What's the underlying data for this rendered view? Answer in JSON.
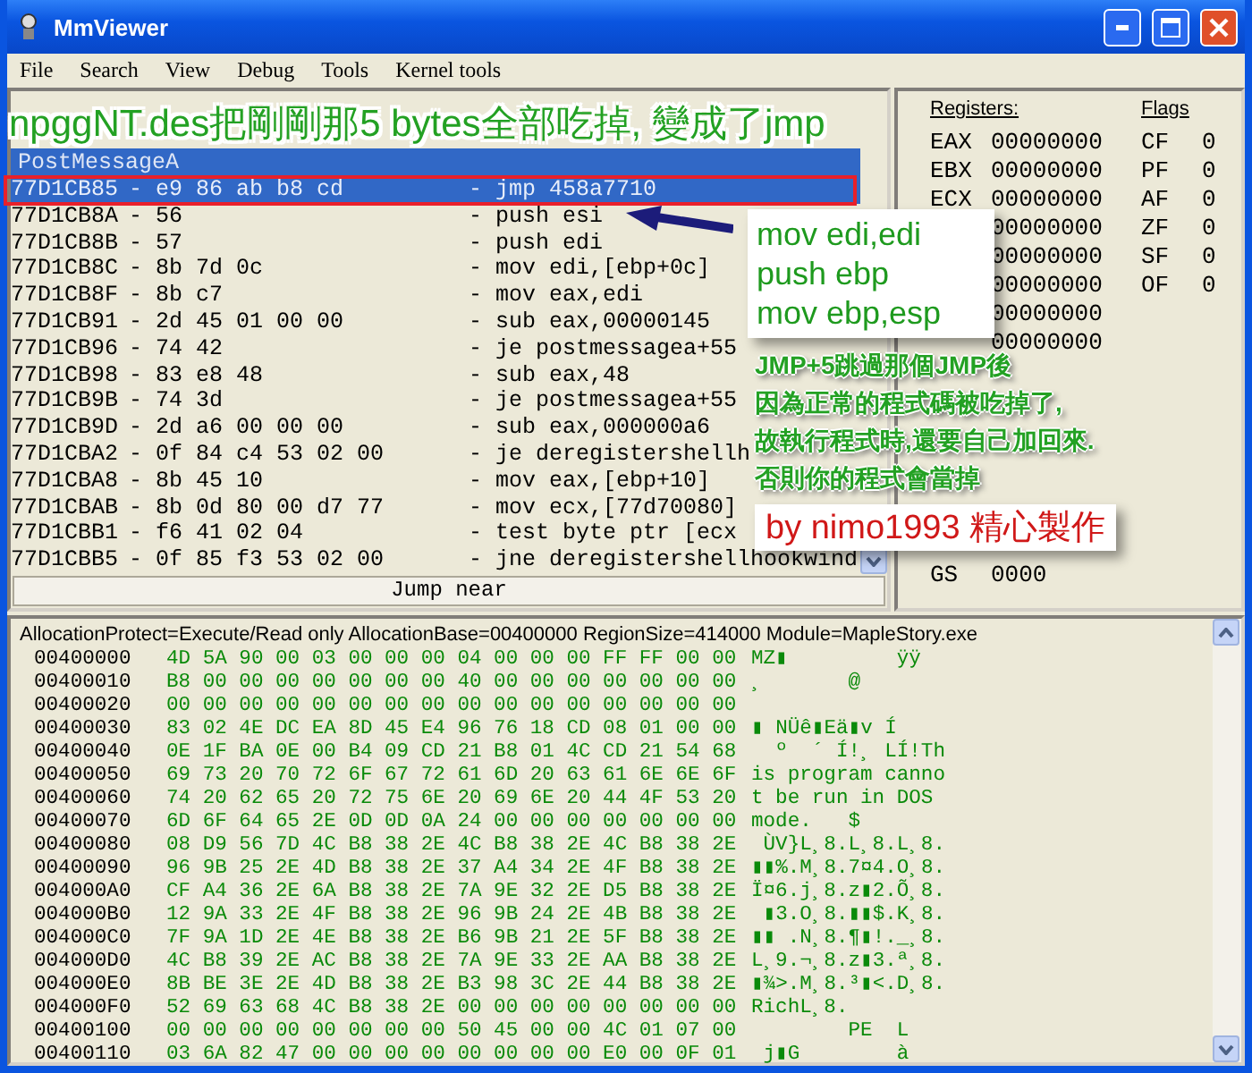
{
  "window": {
    "title": "MmViewer"
  },
  "menu": [
    "File",
    "Search",
    "View",
    "Debug",
    "Tools",
    "Kernel tools"
  ],
  "disassembler": {
    "symbol": "PostMessageA",
    "rows": [
      {
        "address": "77D1CB85",
        "bytes": "- e9 86 ab b8 cd",
        "instruction": "- jmp 458a7710",
        "selected": true
      },
      {
        "address": "77D1CB8A",
        "bytes": "- 56",
        "instruction": "- push esi",
        "selected": false
      },
      {
        "address": "77D1CB8B",
        "bytes": "- 57",
        "instruction": "- push edi",
        "selected": false
      },
      {
        "address": "77D1CB8C",
        "bytes": "- 8b 7d 0c",
        "instruction": "- mov edi,[ebp+0c]",
        "selected": false
      },
      {
        "address": "77D1CB8F",
        "bytes": "- 8b c7",
        "instruction": "- mov eax,edi",
        "selected": false
      },
      {
        "address": "77D1CB91",
        "bytes": "- 2d 45 01 00 00",
        "instruction": "- sub eax,00000145",
        "selected": false
      },
      {
        "address": "77D1CB96",
        "bytes": "- 74 42",
        "instruction": "- je postmessagea+55",
        "selected": false
      },
      {
        "address": "77D1CB98",
        "bytes": "- 83 e8 48",
        "instruction": "- sub eax,48",
        "selected": false
      },
      {
        "address": "77D1CB9B",
        "bytes": "- 74 3d",
        "instruction": "- je postmessagea+55",
        "selected": false
      },
      {
        "address": "77D1CB9D",
        "bytes": "- 2d a6 00 00 00",
        "instruction": "- sub eax,000000a6",
        "selected": false
      },
      {
        "address": "77D1CBA2",
        "bytes": "- 0f 84 c4 53 02 00",
        "instruction": "- je deregistershellh",
        "selected": false
      },
      {
        "address": "77D1CBA8",
        "bytes": "- 8b 45 10",
        "instruction": "- mov eax,[ebp+10]",
        "selected": false
      },
      {
        "address": "77D1CBAB",
        "bytes": "- 8b 0d 80 00 d7 77",
        "instruction": "- mov ecx,[77d70080]",
        "selected": false
      },
      {
        "address": "77D1CBB1",
        "bytes": "- f6 41 02 04",
        "instruction": "- test byte ptr [ecx",
        "selected": false
      },
      {
        "address": "77D1CBB5",
        "bytes": "- 0f 85 f3 53 02 00",
        "instruction": "- jne deregistershellhookwind",
        "selected": false
      }
    ],
    "status": "Jump near"
  },
  "registers": {
    "heading": "Registers:",
    "items": [
      {
        "name": "EAX",
        "value": "00000000"
      },
      {
        "name": "EBX",
        "value": "00000000"
      },
      {
        "name": "ECX",
        "value": "00000000"
      },
      {
        "value": "00000000"
      },
      {
        "value": "00000000"
      },
      {
        "value": "00000000"
      },
      {
        "value": "00000000"
      },
      {
        "value": "00000000"
      }
    ],
    "segments": [
      {
        "name": "GS",
        "value": "0000"
      }
    ]
  },
  "flags": {
    "heading": "Flags",
    "items": [
      {
        "name": "CF",
        "value": "0"
      },
      {
        "name": "PF",
        "value": "0"
      },
      {
        "name": "AF",
        "value": "0"
      },
      {
        "name": "ZF",
        "value": "0"
      },
      {
        "name": "SF",
        "value": "0"
      },
      {
        "name": "OF",
        "value": "0"
      }
    ]
  },
  "memory": {
    "info": "AllocationProtect=Execute/Read only  AllocationBase=00400000 RegionSize=414000 Module=MapleStory.exe",
    "rows": [
      {
        "address": "00400000",
        "bytes": "4D 5A 90 00 03 00 00 00 04 00 00 00 FF FF 00 00",
        "ascii": "MZ▮         ÿÿ"
      },
      {
        "address": "00400010",
        "bytes": "B8 00 00 00 00 00 00 00 40 00 00 00 00 00 00 00",
        "ascii": "¸       @"
      },
      {
        "address": "00400020",
        "bytes": "00 00 00 00 00 00 00 00 00 00 00 00 00 00 00 00"
      },
      {
        "address": "00400030",
        "bytes": "83 02 4E DC EA 8D 45 E4 96 76 18 CD 08 01 00 00",
        "ascii": "▮ NÜê▮Eä▮v Í"
      },
      {
        "address": "00400040",
        "bytes": "0E 1F BA 0E 00 B4 09 CD 21 B8 01 4C CD 21 54 68",
        "ascii": "  º  ´ Í!¸ LÍ!Th"
      },
      {
        "address": "00400050",
        "bytes": "69 73 20 70 72 6F 67 72 61 6D 20 63 61 6E 6E 6F",
        "ascii": "is program canno"
      },
      {
        "address": "00400060",
        "bytes": "74 20 62 65 20 72 75 6E 20 69 6E 20 44 4F 53 20",
        "ascii": "t be run in DOS"
      },
      {
        "address": "00400070",
        "bytes": "6D 6F 64 65 2E 0D 0D 0A 24 00 00 00 00 00 00 00",
        "ascii": "mode.   $"
      },
      {
        "address": "00400080",
        "bytes": "08 D9 56 7D 4C B8 38 2E 4C B8 38 2E 4C B8 38 2E",
        "ascii": " ÙV}L¸8.L¸8.L¸8."
      },
      {
        "address": "00400090",
        "bytes": "96 9B 25 2E 4D B8 38 2E 37 A4 34 2E 4F B8 38 2E",
        "ascii": "▮▮%.M¸8.7¤4.O¸8."
      },
      {
        "address": "004000A0",
        "bytes": "CF A4 36 2E 6A B8 38 2E 7A 9E 32 2E D5 B8 38 2E",
        "ascii": "Ï¤6.j¸8.z▮2.Õ¸8."
      },
      {
        "address": "004000B0",
        "bytes": "12 9A 33 2E 4F B8 38 2E 96 9B 24 2E 4B B8 38 2E",
        "ascii": " ▮3.O¸8.▮▮$.K¸8."
      },
      {
        "address": "004000C0",
        "bytes": "7F 9A 1D 2E 4E B8 38 2E B6 9B 21 2E 5F B8 38 2E",
        "ascii": "▮▮ .N¸8.¶▮!._¸8."
      },
      {
        "address": "004000D0",
        "bytes": "4C B8 39 2E AC B8 38 2E 7A 9E 33 2E AA B8 38 2E",
        "ascii": "L¸9.¬¸8.z▮3.ª¸8."
      },
      {
        "address": "004000E0",
        "bytes": "8B BE 3E 2E 4D B8 38 2E B3 98 3C 2E 44 B8 38 2E",
        "ascii": "▮¾>.M¸8.³▮<.D¸8."
      },
      {
        "address": "004000F0",
        "bytes": "52 69 63 68 4C B8 38 2E 00 00 00 00 00 00 00 00",
        "ascii": "RichL¸8."
      },
      {
        "address": "00400100",
        "bytes": "00 00 00 00 00 00 00 00 50 45 00 00 4C 01 07 00",
        "ascii": "        PE  L"
      },
      {
        "address": "00400110",
        "bytes": "03 6A 82 47 00 00 00 00 00 00 00 00 E0 00 0F 01",
        "ascii": " j▮G        à"
      }
    ]
  },
  "annotations": [
    {
      "kind": "banner",
      "text": "npggNT.des把剛剛那5 bytes全部吃掉, 變成了jmp"
    },
    {
      "kind": "code",
      "lines": [
        "mov edi,edi",
        "push ebp",
        "mov ebp,esp"
      ]
    },
    {
      "kind": "caption",
      "lines": [
        "JMP+5跳過那個JMP後",
        "因為正常的程式碼被吃掉了,",
        "故執行程式時,還要自己加回來.",
        "否則你的程式會當掉"
      ]
    },
    {
      "kind": "signature",
      "text": "by nimo1993 精心製作"
    }
  ]
}
